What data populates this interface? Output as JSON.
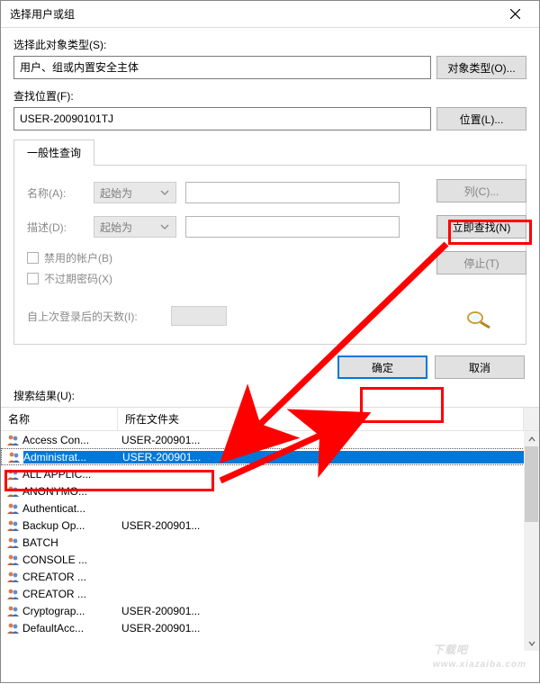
{
  "titlebar": {
    "title": "选择用户或组"
  },
  "object_type": {
    "label": "选择此对象类型(S):",
    "value": "用户、组或内置安全主体",
    "button": "对象类型(O)..."
  },
  "location": {
    "label": "查找位置(F):",
    "value": "USER-20090101TJ",
    "button": "位置(L)..."
  },
  "tab": {
    "label": "一般性查询"
  },
  "form": {
    "name_label": "名称(A):",
    "name_mode": "起始为",
    "desc_label": "描述(D):",
    "desc_mode": "起始为",
    "disabled_accounts": "禁用的帐户(B)",
    "never_expire": "不过期密码(X)",
    "days_label": "自上次登录后的天数(I):"
  },
  "right_buttons": {
    "columns": "列(C)...",
    "find_now": "立即查找(N)",
    "stop": "停止(T)"
  },
  "bottom": {
    "ok": "确定",
    "cancel": "取消"
  },
  "results_label": "搜索结果(U):",
  "columns": {
    "name": "名称",
    "folder": "所在文件夹"
  },
  "rows": [
    {
      "name": "Access Con...",
      "folder": "USER-200901..."
    },
    {
      "name": "Administrat...",
      "folder": "USER-200901...",
      "selected": true
    },
    {
      "name": "ALL APPLIC...",
      "folder": ""
    },
    {
      "name": "ANONYMO...",
      "folder": ""
    },
    {
      "name": "Authenticat...",
      "folder": ""
    },
    {
      "name": "Backup Op...",
      "folder": "USER-200901..."
    },
    {
      "name": "BATCH",
      "folder": ""
    },
    {
      "name": "CONSOLE ...",
      "folder": ""
    },
    {
      "name": "CREATOR ...",
      "folder": ""
    },
    {
      "name": "CREATOR ...",
      "folder": ""
    },
    {
      "name": "Cryptograp...",
      "folder": "USER-200901..."
    },
    {
      "name": "DefaultAcc...",
      "folder": "USER-200901..."
    }
  ],
  "watermark": {
    "main": "下载吧",
    "sub": "www.xiazaiba.com"
  }
}
